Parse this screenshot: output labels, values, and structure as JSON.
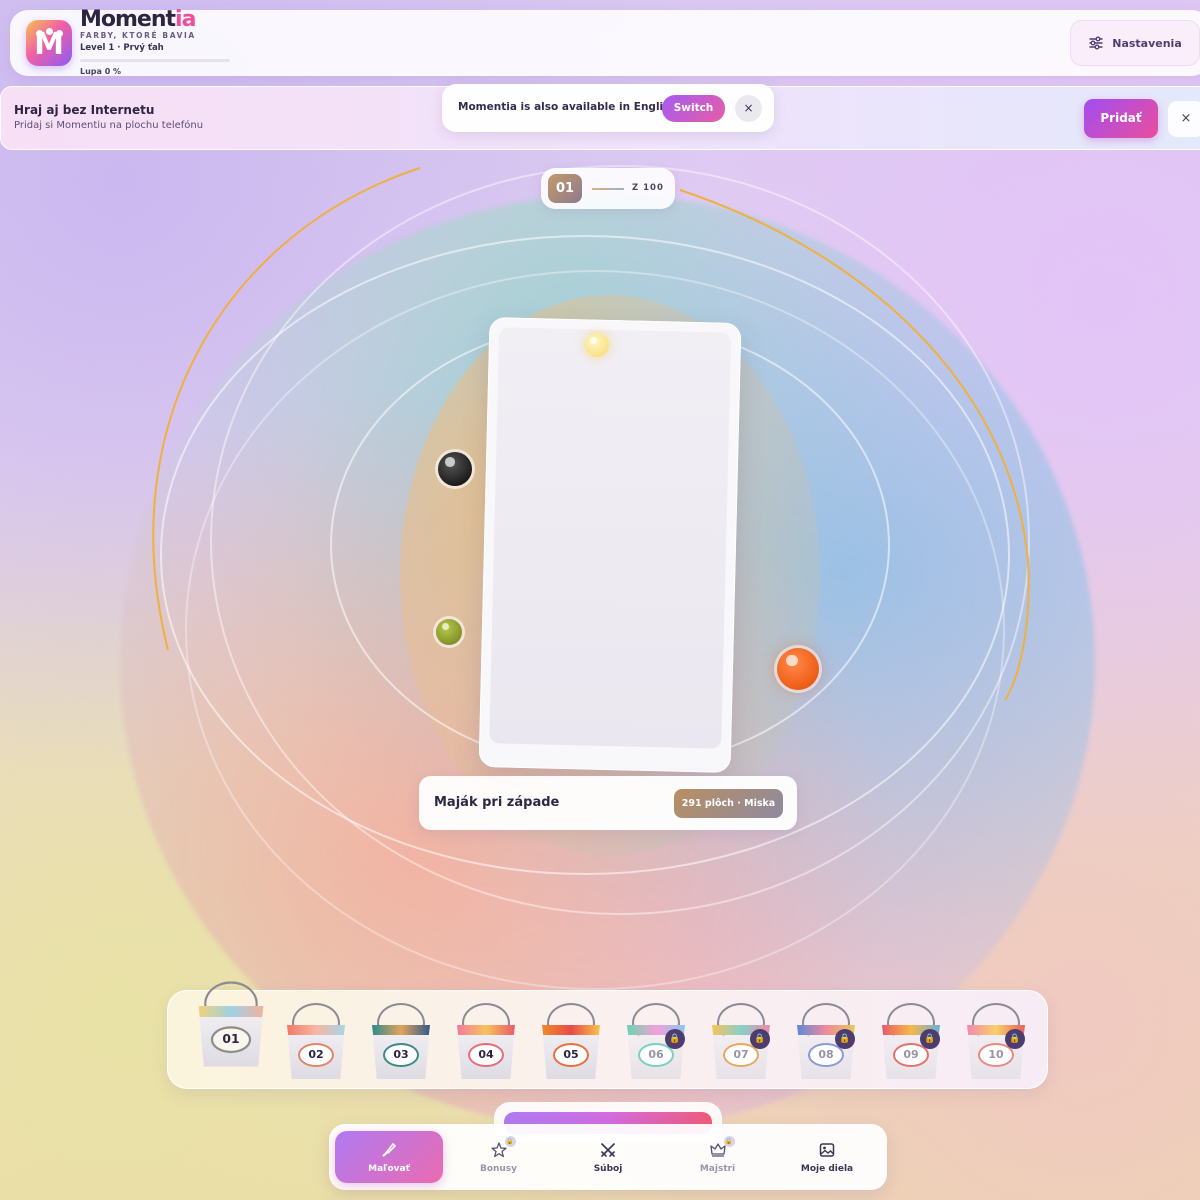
{
  "app": {
    "brand_main": "Moment",
    "brand_accent": "ia",
    "logo_letter": "M",
    "tagline": "FARBY, KTORÉ BAVIA",
    "level_text": "Level 1 · Prvý ťah",
    "lupa_label": "Lupa 0 %",
    "lupa_progress": 0
  },
  "header": {
    "settings_label": "Nastavenia",
    "settings_icon": "sliders-icon"
  },
  "install_banner": {
    "title": "Hraj aj bez Internetu",
    "subtitle": "Pridaj si Momentiu na plochu telefónu",
    "add_label": "Pridať",
    "close_label": "×"
  },
  "language_popup": {
    "text": "Momentia is also available in English",
    "switch_label": "Switch",
    "close_label": "×"
  },
  "counter": {
    "current": "01",
    "total_label": "Z 100"
  },
  "painting": {
    "title": "Maják pri západe",
    "badge": "291 plôch · Miska"
  },
  "colors": {
    "accent_purple": "#a24df2",
    "accent_pink": "#e94e9c",
    "ball_yellow": "#fbe38a",
    "ball_black": "#111111",
    "ball_olive": "#8a9a2a",
    "ball_orange": "#f35a10"
  },
  "buckets": [
    {
      "label": "01",
      "locked": false,
      "active": true,
      "paint": "linear-gradient(90deg,#f2d27a,#9ed1e3,#f3b1a0)",
      "ring": "#8a8f87"
    },
    {
      "label": "02",
      "locked": false,
      "active": false,
      "paint": "linear-gradient(90deg,#f07a68,#f6b7a3,#a8d6e6)",
      "ring": "#e0856a"
    },
    {
      "label": "03",
      "locked": false,
      "active": false,
      "paint": "linear-gradient(90deg,#2f8a8f,#e3a35a,#2e5a8c)",
      "ring": "#3c8a88"
    },
    {
      "label": "04",
      "locked": false,
      "active": false,
      "paint": "linear-gradient(90deg,#f57aa0,#f7c35a,#e85b6a)",
      "ring": "#e86b7a"
    },
    {
      "label": "05",
      "locked": false,
      "active": false,
      "paint": "linear-gradient(90deg,#f08a2a,#e84a4a,#f7c44a)",
      "ring": "#e8703a"
    },
    {
      "label": "06",
      "locked": true,
      "active": false,
      "paint": "linear-gradient(90deg,#6ad5b0,#f3a0d8,#8ac8f0)",
      "ring": "#7ad0b8"
    },
    {
      "label": "07",
      "locked": true,
      "active": false,
      "paint": "linear-gradient(90deg,#f7c45a,#88d0c8,#f08aa8)",
      "ring": "#e8a860"
    },
    {
      "label": "08",
      "locked": true,
      "active": false,
      "paint": "linear-gradient(90deg,#5a8ad8,#f08a9a,#e8c85a)",
      "ring": "#8a9ad8"
    },
    {
      "label": "09",
      "locked": true,
      "active": false,
      "paint": "linear-gradient(90deg,#e85a6a,#f7b84a,#6ab0d8)",
      "ring": "#e8706a"
    },
    {
      "label": "10",
      "locked": true,
      "active": false,
      "paint": "linear-gradient(90deg,#f08ab0,#f7d06a,#e8605a)",
      "ring": "#e88a80"
    }
  ],
  "lock_icon": "🔒",
  "nav": [
    {
      "name": "nav-paint",
      "label": "Maľovať",
      "icon": "brush-icon",
      "active": true,
      "locked": false
    },
    {
      "name": "nav-bonuses",
      "label": "Bonusy",
      "icon": "star-icon",
      "active": false,
      "locked": true
    },
    {
      "name": "nav-duel",
      "label": "Súboj",
      "icon": "swords-icon",
      "active": false,
      "locked": false
    },
    {
      "name": "nav-masters",
      "label": "Majstri",
      "icon": "crown-icon",
      "active": false,
      "locked": true
    },
    {
      "name": "nav-gallery",
      "label": "Moje diela",
      "icon": "image-icon",
      "active": false,
      "locked": false
    }
  ]
}
